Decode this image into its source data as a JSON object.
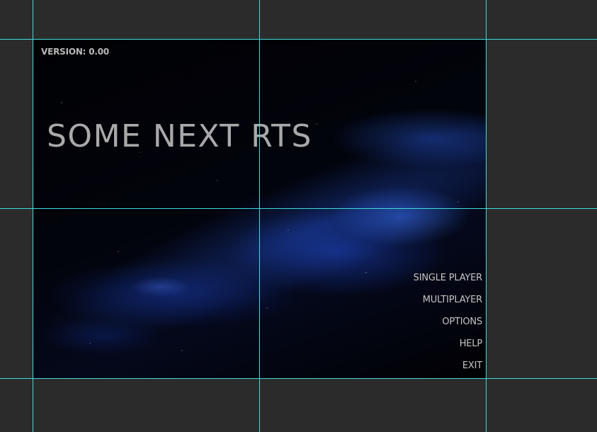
{
  "version_label": "VERSION: 0.00",
  "title": "SOME NEXT RTS",
  "menu": {
    "items": [
      {
        "label": "SINGLE PLAYER"
      },
      {
        "label": "MULTIPLAYER"
      },
      {
        "label": "OPTIONS"
      },
      {
        "label": "HELP"
      },
      {
        "label": "EXIT"
      }
    ]
  },
  "colors": {
    "workspace_bg": "#2b2b2b",
    "guide_lines": "#3fdcdc",
    "text": "#b8b8b8",
    "nebula_accent": "#2f6bff"
  }
}
